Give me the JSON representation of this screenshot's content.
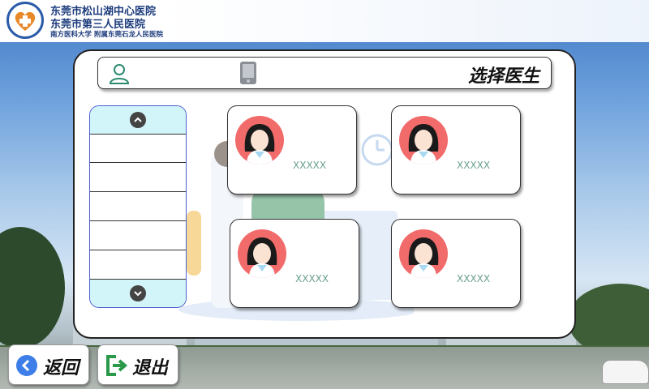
{
  "header": {
    "line1": "东莞市松山湖中心医院",
    "line2": "东莞市第三人民医院",
    "line3": "南方医科大学 附属东莞石龙人民医院"
  },
  "title": "选择医生",
  "doctors": [
    {
      "name": "XXXXX"
    },
    {
      "name": "XXXXX"
    },
    {
      "name": "XXXXX"
    },
    {
      "name": "XXXXX"
    }
  ],
  "footer": {
    "back_label": "返回",
    "exit_label": "退出"
  },
  "colors": {
    "accent": "#2a5ba8",
    "photo_bg": "#f26b6b",
    "name_text": "#6a9f8f",
    "list_cap": "#d2f5fa"
  }
}
